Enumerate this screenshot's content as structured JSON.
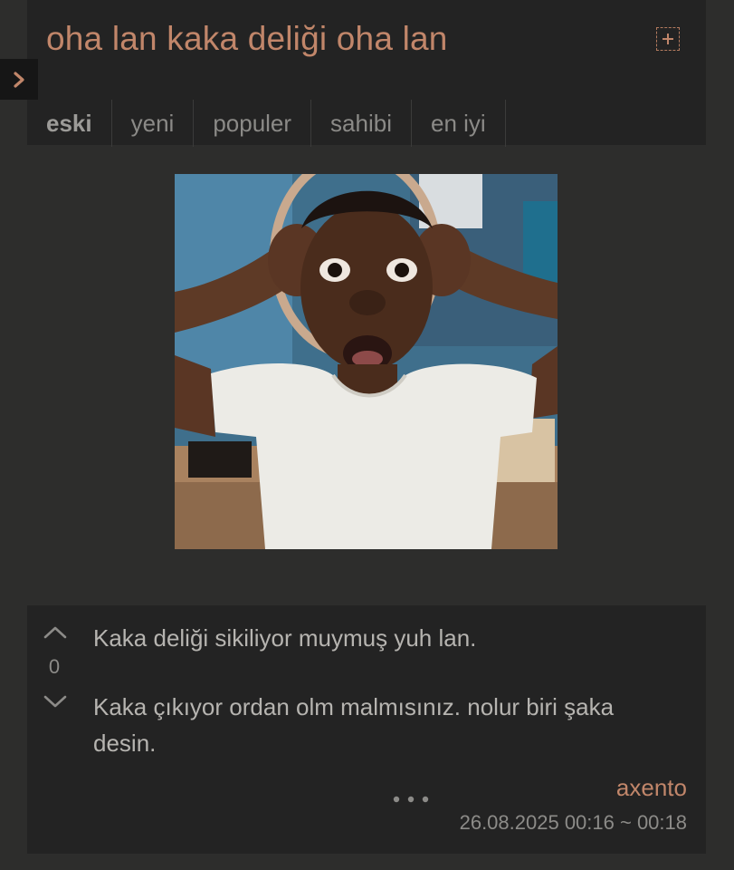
{
  "topic": {
    "title": "oha lan kaka deliği oha lan"
  },
  "tabs": [
    {
      "label": "eski"
    },
    {
      "label": "yeni"
    },
    {
      "label": "populer"
    },
    {
      "label": "sahibi"
    },
    {
      "label": "en iyi"
    }
  ],
  "colors": {
    "accent": "#c1866a",
    "background": "#2d2d2c",
    "panel": "#232323",
    "text": "#b6b4b0",
    "muted": "#8c8b88"
  },
  "icons": {
    "follow": "plus-box-icon",
    "sidebar": "chevron-right-icon",
    "upvote": "chevron-up-icon",
    "downvote": "chevron-down-icon",
    "more": "more-dots-icon"
  },
  "entry": {
    "vote_count": "0",
    "paragraphs": [
      "Kaka deliği sikiliyor muymuş yuh lan.",
      "Kaka çıkıyor ordan olm malmısınız. nolur biri şaka desin."
    ],
    "author": "axento",
    "date": "26.08.2025 00:16 ~ 00:18"
  }
}
